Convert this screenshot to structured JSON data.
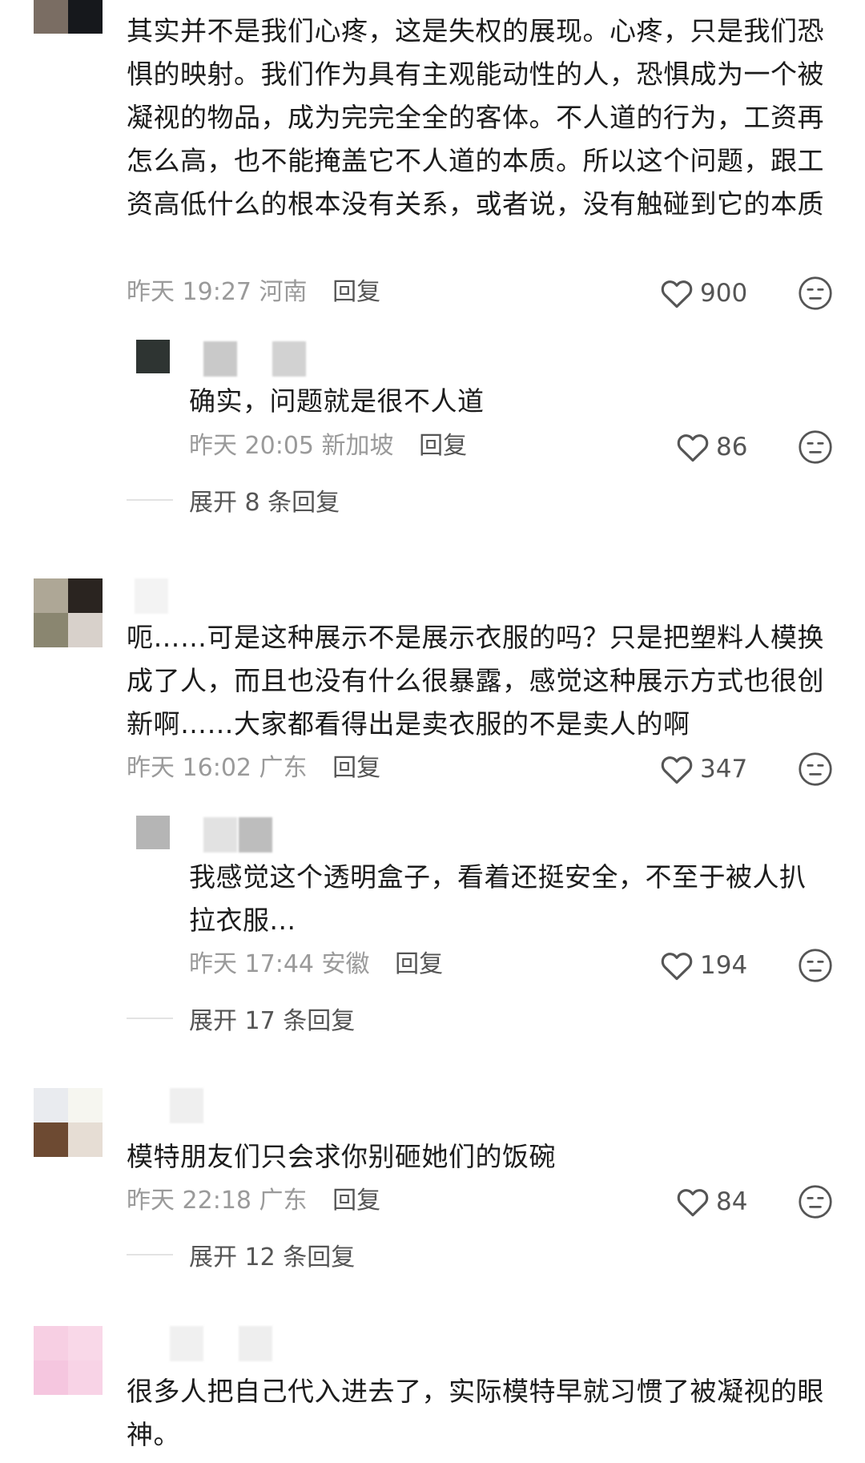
{
  "comments": [
    {
      "text": "其实并不是我们心疼，这是失权的展现。心疼，只是我们恐惧的映射。我们作为具有主观能动性的人，恐惧成为一个被凝视的物品，成为完完全全的客体。不人道的行为，工资再怎么高，也不能掩盖它不人道的本质。所以这个问题，跟工资高低什么的根本没有关系，或者说，没有触碰到它的本质",
      "time": "昨天 19:27",
      "location": "河南",
      "reply_label": "回复",
      "likes": "900",
      "reply": {
        "text": "确实，问题就是很不人道",
        "time": "昨天 20:05",
        "location": "新加坡",
        "reply_label": "回复",
        "likes": "86"
      },
      "expand_label": "展开 8 条回复"
    },
    {
      "text": "呃……可是这种展示不是展示衣服的吗？只是把塑料人模换成了人，而且也没有什么很暴露，感觉这种展示方式也很创新啊……大家都看得出是卖衣服的不是卖人的啊",
      "time": "昨天 16:02",
      "location": "广东",
      "reply_label": "回复",
      "likes": "347",
      "reply": {
        "text": "我感觉这个透明盒子，看着还挺安全，不至于被人扒拉衣服...",
        "time": "昨天 17:44",
        "location": "安徽",
        "reply_label": "回复",
        "likes": "194"
      },
      "expand_label": "展开 17 条回复"
    },
    {
      "text": "模特朋友们只会求你别砸她们的饭碗",
      "time": "昨天 22:18",
      "location": "广东",
      "reply_label": "回复",
      "likes": "84",
      "expand_label": "展开 12 条回复"
    },
    {
      "text": "很多人把自己代入进去了，实际模特早就习惯了被凝视的眼神。"
    }
  ],
  "icons": {
    "like": "heart-outline-icon",
    "dislike": "meh-face-icon"
  },
  "colors": {
    "text": "#1c1c1c",
    "meta": "#9a9a9a",
    "action": "#555555"
  }
}
